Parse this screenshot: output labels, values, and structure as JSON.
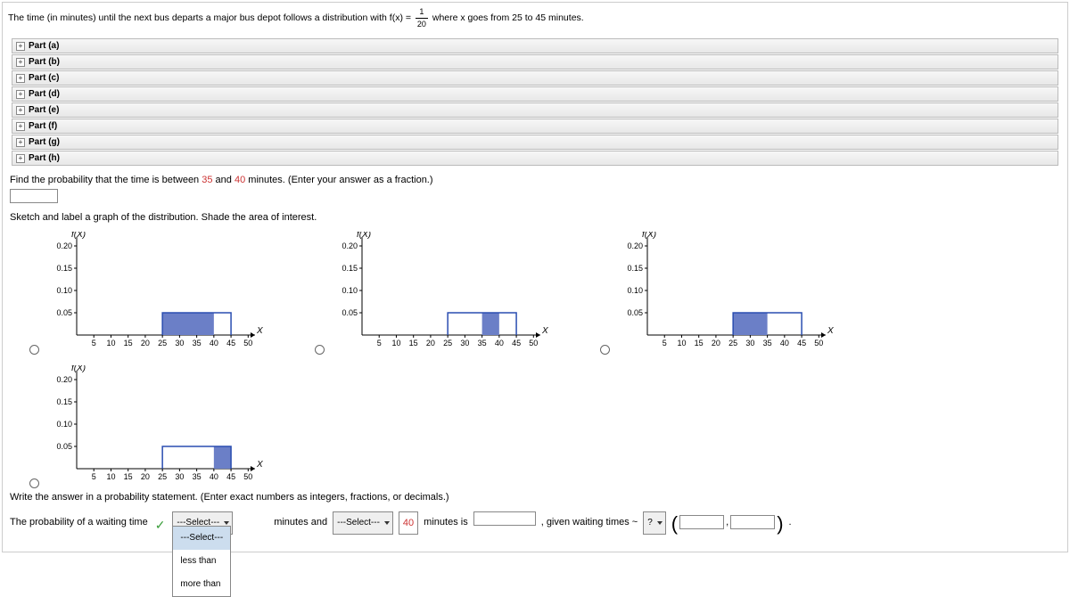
{
  "problem": {
    "intro_a": "The time (in minutes) until the next bus departs a major bus depot follows a distribution with  f(x) = ",
    "frac_num": "1",
    "frac_den": "20",
    "intro_b": "  where x goes from 25 to 45 minutes."
  },
  "parts": [
    "Part (a)",
    "Part (b)",
    "Part (c)",
    "Part (d)",
    "Part (e)",
    "Part (f)",
    "Part (g)",
    "Part (h)"
  ],
  "q1": {
    "text_a": "Find the probability that the time is between ",
    "v1": "35",
    "text_b": " and ",
    "v2": "40",
    "text_c": " minutes. (Enter your answer as a fraction.)"
  },
  "q2": "Sketch and label a graph of the distribution. Shade the area of interest.",
  "chart_data": [
    {
      "type": "bar",
      "xlabel": "X",
      "ylabel": "f(X)",
      "xticks": [
        5,
        10,
        15,
        20,
        25,
        30,
        35,
        40,
        45,
        50
      ],
      "yticks": [
        0.05,
        0.1,
        0.15,
        0.2
      ],
      "platform": {
        "x0": 25,
        "x1": 45,
        "y": 0.05
      },
      "shade": {
        "x0": 25,
        "x1": 40,
        "y": 0.05
      }
    },
    {
      "type": "bar",
      "xlabel": "X",
      "ylabel": "f(X)",
      "xticks": [
        5,
        10,
        15,
        20,
        25,
        30,
        35,
        40,
        45,
        50
      ],
      "yticks": [
        0.05,
        0.1,
        0.15,
        0.2
      ],
      "platform": {
        "x0": 25,
        "x1": 45,
        "y": 0.05
      },
      "shade": {
        "x0": 35,
        "x1": 40,
        "y": 0.05
      }
    },
    {
      "type": "bar",
      "xlabel": "X",
      "ylabel": "f(X)",
      "xticks": [
        5,
        10,
        15,
        20,
        25,
        30,
        35,
        40,
        45,
        50
      ],
      "yticks": [
        0.05,
        0.1,
        0.15,
        0.2
      ],
      "platform": {
        "x0": 25,
        "x1": 45,
        "y": 0.05
      },
      "shade": {
        "x0": 25,
        "x1": 35,
        "y": 0.05
      }
    },
    {
      "type": "bar",
      "xlabel": "X",
      "ylabel": "f(X)",
      "xticks": [
        5,
        10,
        15,
        20,
        25,
        30,
        35,
        40,
        45,
        50
      ],
      "yticks": [
        0.05,
        0.1,
        0.15,
        0.2
      ],
      "platform": {
        "x0": 25,
        "x1": 45,
        "y": 0.05
      },
      "shade": {
        "x0": 40,
        "x1": 45,
        "y": 0.05
      }
    }
  ],
  "q3": "Write the answer in a probability statement. (Enter exact numbers as integers, fractions, or decimals.)",
  "statement": {
    "lead": "The probability of a waiting time",
    "drop1": {
      "selected": "---Select---",
      "options": [
        "---Select---",
        "less than",
        "more than"
      ]
    },
    "t1": "minutes and",
    "drop2": {
      "selected": "---Select---"
    },
    "boxed": "40",
    "t2": " minutes is ",
    "t3": ", given waiting times ~ ",
    "drop3": {
      "selected": "?"
    },
    "comma": ","
  }
}
